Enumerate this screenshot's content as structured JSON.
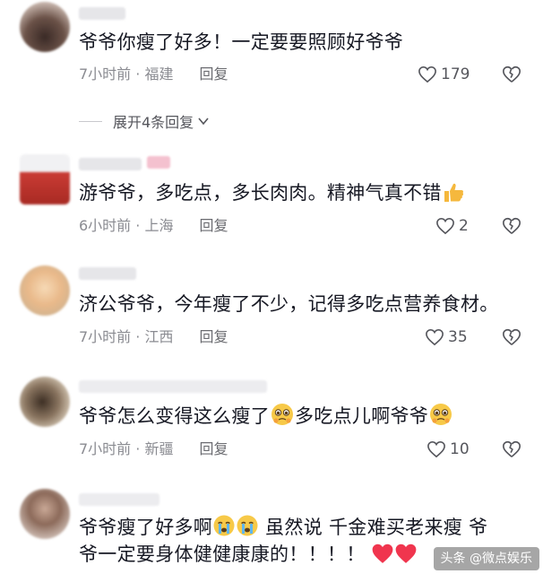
{
  "comments": [
    {
      "text": "爷爷你瘦了好多！一定要要照顾好爷爷",
      "time": "7小时前 · 福建",
      "reply": "回复",
      "likes": "179"
    },
    {
      "text": "游爷爷，多吃点，多长肉肉。精神气真不错",
      "time": "6小时前 · 上海",
      "reply": "回复",
      "likes": "2"
    },
    {
      "text": "济公爷爷，今年瘦了不少，记得多吃点营养食材。",
      "time": "7小时前 · 江西",
      "reply": "回复",
      "likes": "35"
    },
    {
      "text_a": "爷爷怎么变得这么瘦了",
      "text_b": "多吃点儿啊爷爷",
      "time": "7小时前 · 新疆",
      "reply": "回复",
      "likes": "10"
    },
    {
      "line1_a": "爷爷瘦了好多啊",
      "line1_b": "虽然说 千金难买老来瘦 爷",
      "line2": "爷一定要身体健健康康的！！！！"
    }
  ],
  "expand_replies": "展开4条回复",
  "watermark": "头条 @微点娱乐",
  "colors": {
    "text": "#161823",
    "meta": "#8a8b91",
    "heart_red": "#f0354e"
  }
}
